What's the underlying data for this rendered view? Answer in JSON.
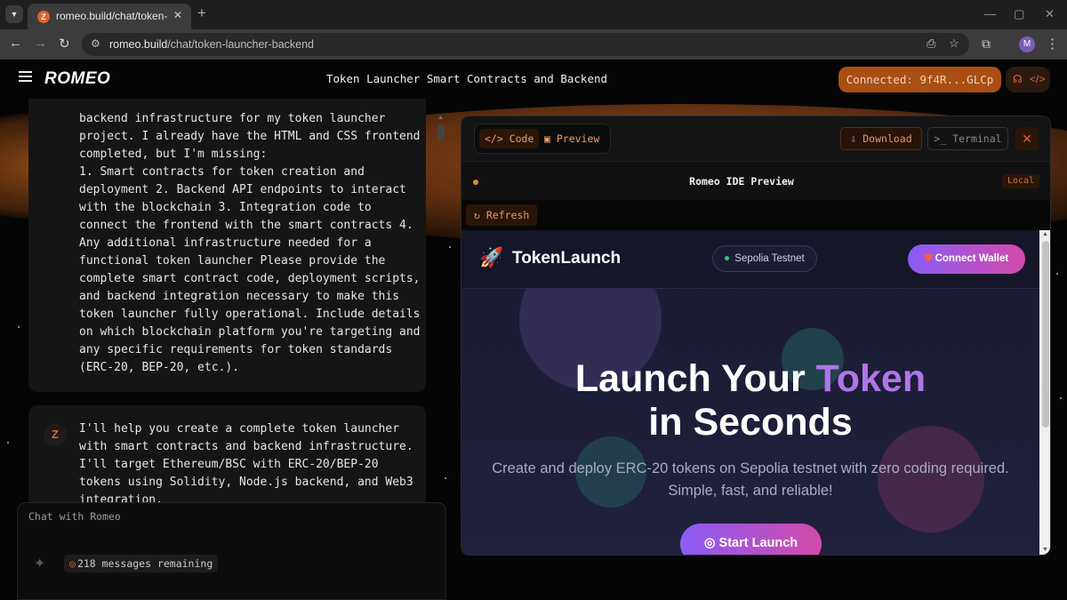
{
  "browser": {
    "tab_title": "romeo.build/chat/token-launch",
    "tab_favicon": "Z",
    "tab_close": "✕",
    "new_tab": "+",
    "url_host": "romeo.build",
    "url_path": "/chat/token-launcher-backend",
    "profile_initial": "M",
    "window_controls": {
      "minimize": "—",
      "maximize": "▢",
      "close": "✕"
    }
  },
  "app": {
    "logo": "ROMEO",
    "chat_title": "Token Launcher Smart Contracts and Backend",
    "connected_label": "Connected: 9f4R...GLCp",
    "accent_color": "#e0612c"
  },
  "chat": {
    "user_message": "backend infrastructure for my token launcher\nproject. I already have the HTML and CSS frontend\ncompleted, but I'm missing:\n1. Smart contracts for token creation and\ndeployment 2. Backend API endpoints to interact\nwith the blockchain 3. Integration code to\nconnect the frontend with the smart contracts 4.\nAny additional infrastructure needed for a\nfunctional token launcher Please provide the\ncomplete smart contract code, deployment scripts,\nand backend integration necessary to make this\ntoken launcher fully operational. Include details\non which blockchain platform you're targeting and\nany specific requirements for token standards\n(ERC-20, BEP-20, etc.).",
    "assistant_avatar": "Z",
    "assistant_message": "I'll help you create a complete token launcher\nwith smart contracts and backend infrastructure.\nI'll target Ethereum/BSC with ERC-20/BEP-20\ntokens using Solidity, Node.js backend, and Web3\nintegration.",
    "input_placeholder": "Chat with Romeo",
    "messages_remaining": "218 messages remaining"
  },
  "ide": {
    "tab_code": "Code",
    "tab_preview": "Preview",
    "download": "Download",
    "terminal": "Terminal",
    "preview_title": "Romeo IDE Preview",
    "badge": "Local",
    "refresh": "Refresh"
  },
  "site": {
    "logo": "TokenLaunch",
    "network": "Sepolia Testnet",
    "connect_wallet": "Connect Wallet",
    "hero_line1_a": "Launch Your ",
    "hero_line1_b": "Token",
    "hero_line2": "in Seconds",
    "subtitle_1": "Create and deploy ERC-20 tokens on Sepolia testnet with zero coding required.",
    "subtitle_2": "Simple, fast, and reliable!",
    "cta": "Start Launch"
  }
}
